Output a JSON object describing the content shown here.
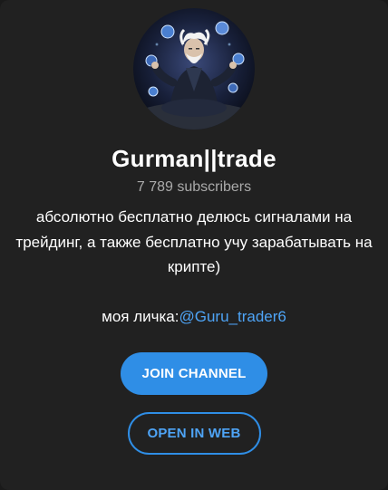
{
  "channel": {
    "title": "Gurman||trade",
    "subscribers": "7 789 subscribers",
    "description": "абсолютно бесплатно делюсь сигналами на трейдинг, а также бесплатно учу зарабатывать на крипте)",
    "contact_prefix": "моя личка:",
    "contact_handle": "@Guru_trader6"
  },
  "buttons": {
    "join": "JOIN CHANNEL",
    "web": "OPEN IN WEB"
  },
  "avatar": {
    "icon": "channel-avatar-meditating-sage"
  },
  "colors": {
    "background": "#212121",
    "accent": "#2f8ee6",
    "link": "#4ea4f6",
    "muted": "#aaaaaa",
    "text": "#ffffff"
  }
}
